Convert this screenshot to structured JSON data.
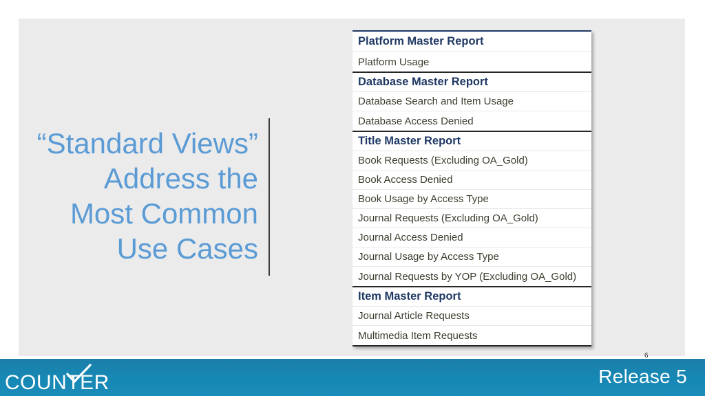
{
  "slide": {
    "heading": "“Standard Views”\nAddress the\nMost Common\nUse Cases",
    "heading_color": "#5B9BD5",
    "panel_color": "#EBEBEB",
    "page_number": "6"
  },
  "report_table": {
    "header_color": "#1F3864",
    "item_color": "#3C3C2E",
    "groups": [
      {
        "title": "Platform Master Report",
        "items": [
          "Platform Usage"
        ]
      },
      {
        "title": "Database Master Report",
        "items": [
          "Database Search and Item Usage",
          "Database Access Denied"
        ]
      },
      {
        "title": "Title Master Report",
        "items": [
          "Book Requests (Excluding OA_Gold)",
          "Book Access Denied",
          "Book Usage by Access Type",
          "Journal Requests (Excluding OA_Gold)",
          "Journal Access Denied",
          "Journal Usage by Access Type",
          "Journal Requests by YOP (Excluding OA_Gold)"
        ]
      },
      {
        "title": "Item Master Report",
        "items": [
          "Journal Article Requests",
          "Multimedia Item Requests"
        ]
      }
    ]
  },
  "footer": {
    "logo_text": "COUNTER",
    "release_label": "Release 5",
    "bar_color": "#1688B5"
  }
}
